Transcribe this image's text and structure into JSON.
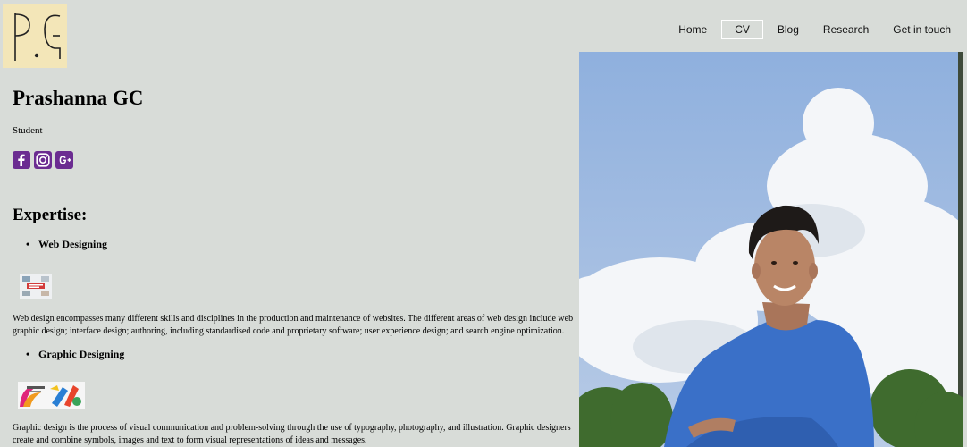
{
  "logo": {
    "text": "P.G"
  },
  "nav": {
    "home": "Home",
    "cv": "CV",
    "blog": "Blog",
    "research": "Research",
    "contact": "Get in touch"
  },
  "profile": {
    "name": "Prashanna GC",
    "role": "Student"
  },
  "social": {
    "icons": [
      "facebook-icon",
      "instagram-icon",
      "google-plus-icon"
    ],
    "color": "#6b2c91"
  },
  "expertise": {
    "title": "Expertise:",
    "items": [
      {
        "title": "Web Designing",
        "description": "Web design encompasses many different skills and disciplines in the production and maintenance of websites. The different areas of web design include web graphic design; interface design; authoring, including standardised code and proprietary software; user experience design; and search engine optimization."
      },
      {
        "title": "Graphic Designing",
        "description": "Graphic design is the process of visual communication and problem-solving through the use of typography, photography, and illustration. Graphic designers create and combine symbols, images and text to form visual representations of ideas and messages."
      }
    ]
  },
  "colors": {
    "background": "#d8dcd8",
    "logo_bg": "#f3e6b8",
    "sky": "#a9c0e0",
    "sweater": "#3a70c8"
  }
}
